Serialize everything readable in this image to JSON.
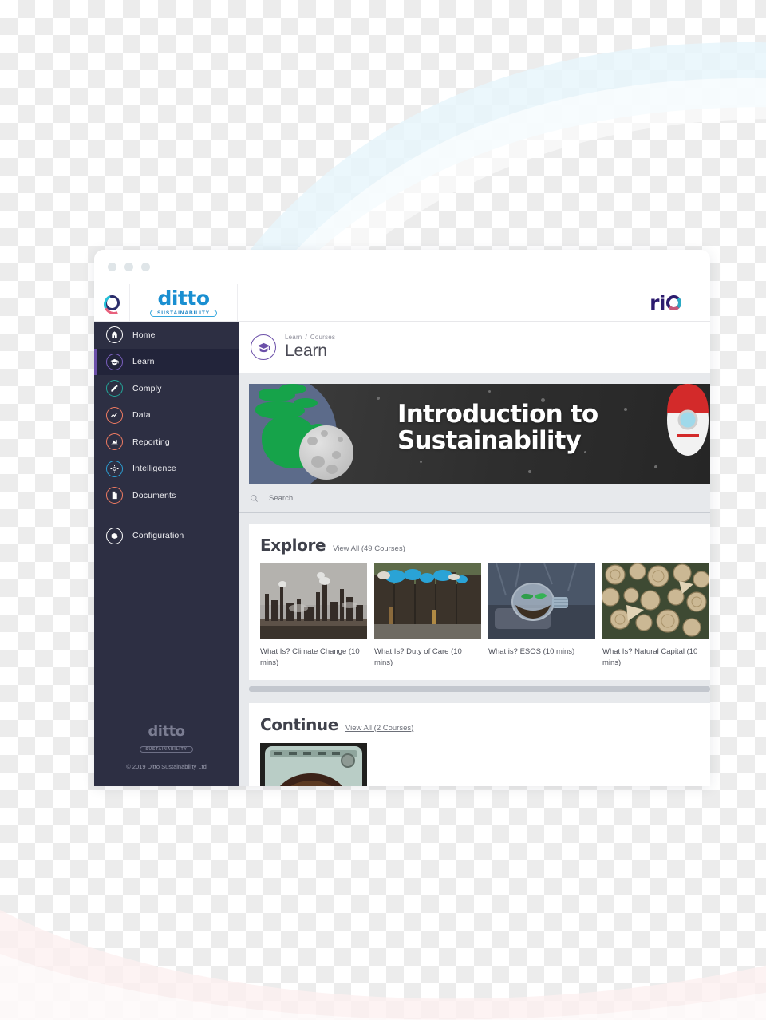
{
  "brand": {
    "mark_icon": "ditto-ring-icon",
    "logo_word": "ditto",
    "logo_tagline": "SUSTAINABILITY",
    "tenant_logo": "rio"
  },
  "window": {
    "dots": [
      "close-dot",
      "minimize-dot",
      "maximize-dot"
    ]
  },
  "sidebar": {
    "items": [
      {
        "label": "Home",
        "icon": "home-icon",
        "color": "#ffffff",
        "active": false
      },
      {
        "label": "Learn",
        "icon": "graduation-cap-icon",
        "color": "#7b5fc0",
        "active": true
      },
      {
        "label": "Comply",
        "icon": "pencil-icon",
        "color": "#23a699",
        "active": false
      },
      {
        "label": "Data",
        "icon": "chart-line-icon",
        "color": "#ef7b62",
        "active": false
      },
      {
        "label": "Reporting",
        "icon": "bar-chart-icon",
        "color": "#ef7b62",
        "active": false
      },
      {
        "label": "Intelligence",
        "icon": "target-icon",
        "color": "#2b9fd4",
        "active": false
      },
      {
        "label": "Documents",
        "icon": "document-icon",
        "color": "#ef7b62",
        "active": false
      }
    ],
    "config": {
      "label": "Configuration",
      "icon": "gear-icon",
      "color": "#ffffff"
    },
    "footer": {
      "logo_word": "ditto",
      "logo_tagline": "SUSTAINABILITY",
      "copyright": "© 2019 Ditto Sustainability Ltd"
    }
  },
  "page": {
    "icon": "graduation-cap-icon",
    "breadcrumb": {
      "parent": "Learn",
      "separator": "/",
      "current": "Courses"
    },
    "title": "Learn"
  },
  "banner": {
    "line1": "Introduction to",
    "line2": "Sustainability",
    "art": [
      "earth-illustration",
      "moon-illustration",
      "rocket-illustration",
      "stars"
    ]
  },
  "search": {
    "icon": "search-icon",
    "placeholder": "Search",
    "value": ""
  },
  "shelves": [
    {
      "title": "Explore",
      "view_all": "View All (49 Courses)",
      "cards": [
        {
          "title": "What Is? Climate Change (10 mins)",
          "thumb": "industrial-refinery-photo"
        },
        {
          "title": "What Is? Duty of Care (10 mins)",
          "thumb": "waste-bales-photo"
        },
        {
          "title": "What is? ESOS (10 mins)",
          "thumb": "lightbulb-plant-photo"
        },
        {
          "title": "What Is? Natural Capital (10 mins)",
          "thumb": "stacked-logs-photo"
        }
      ]
    },
    {
      "title": "Continue",
      "view_all": "View All (2 Courses)",
      "cards": [
        {
          "title": "",
          "thumb": "vintage-gauge-photo"
        }
      ]
    }
  ],
  "colors": {
    "sidebar_bg": "#2d2f43",
    "sidebar_active_bg": "#22243a",
    "accent_purple": "#6b4fa8",
    "brand_blue": "#1a8fd1",
    "rio_navy": "#2c1b6e",
    "content_bg": "#e7e9ec"
  }
}
